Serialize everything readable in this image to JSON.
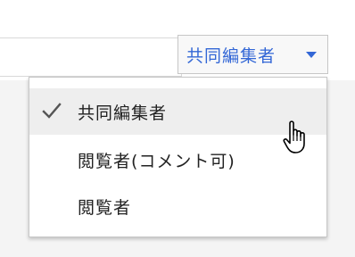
{
  "role_dropdown": {
    "selected_label": "共同編集者"
  },
  "role_menu": {
    "items": [
      {
        "label": "共同編集者",
        "checked": true
      },
      {
        "label": "閲覧者(コメント可)",
        "checked": false
      },
      {
        "label": "閲覧者",
        "checked": false
      }
    ]
  },
  "icons": {
    "dropdown_caret": "caret-down-icon",
    "checkmark": "check-icon",
    "pointer": "hand-pointer-icon"
  },
  "colors": {
    "accent": "#3367d6",
    "highlight": "#eeeeee"
  }
}
